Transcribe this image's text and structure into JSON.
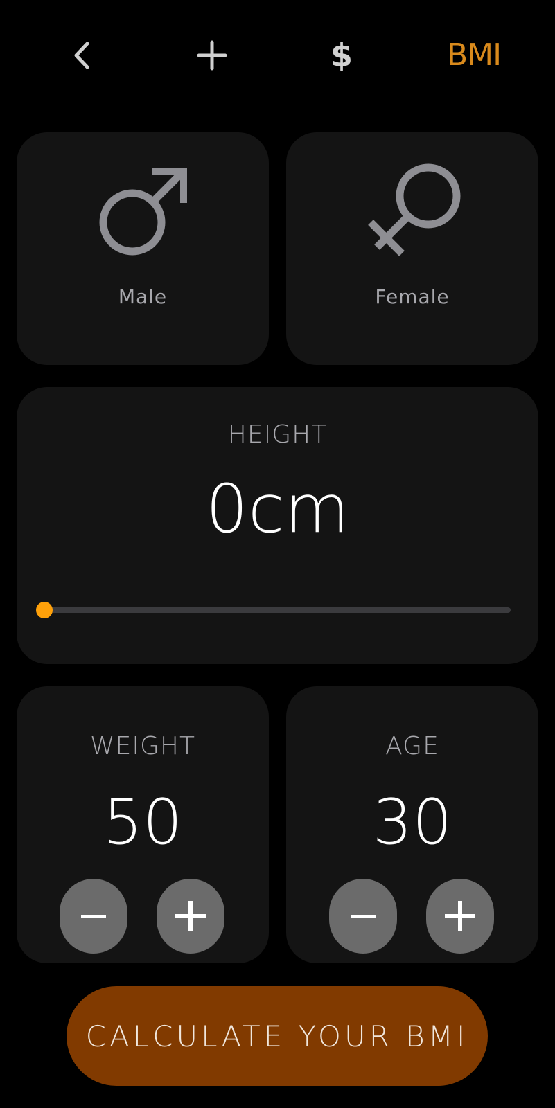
{
  "colors": {
    "background": "#000000",
    "card": "#141414",
    "accent": "#ffa10a",
    "bmi_tab": "#d98a1c",
    "icon_gray": "#8e8e93",
    "label_gray": "#a8a8ad",
    "button_gray": "#6b6b6b",
    "calc_button": "#813a00",
    "slider_track": "#3b3b3e"
  },
  "nav": {
    "back_icon": "chevron-left-icon",
    "add_icon": "plus-icon",
    "currency_label": "$",
    "bmi_label": "BMI"
  },
  "gender": {
    "male": {
      "icon": "male-symbol-icon",
      "label": "Male"
    },
    "female": {
      "icon": "female-symbol-icon",
      "label": "Female"
    }
  },
  "height": {
    "label": "HEIGHT",
    "value": "0",
    "unit": "cm",
    "slider_fraction": 0
  },
  "weight": {
    "label": "WEIGHT",
    "value": "50",
    "minus_icon": "minus-icon",
    "plus_icon": "plus-icon"
  },
  "age": {
    "label": "AGE",
    "value": "30",
    "minus_icon": "minus-icon",
    "plus_icon": "plus-icon"
  },
  "calculate": {
    "label": "CALCULATE YOUR BMI"
  }
}
